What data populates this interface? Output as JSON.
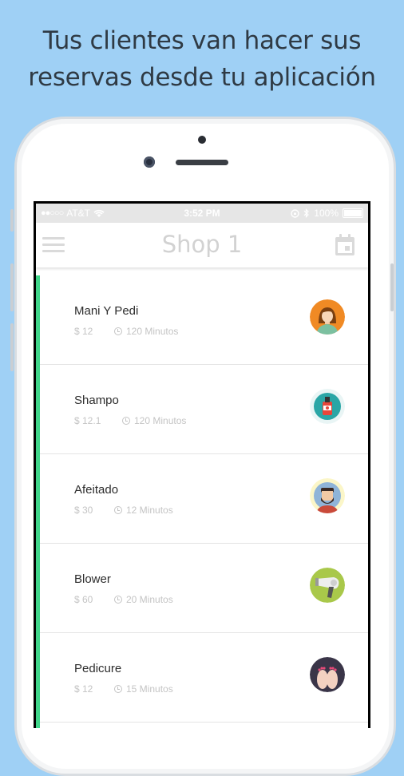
{
  "headline": {
    "line1": "Tus clientes van hacer sus",
    "line2": "reservas desde tu aplicación"
  },
  "status_bar": {
    "carrier": "AT&T",
    "time": "3:52 PM",
    "battery": "100%",
    "signal_dots": "●●○○○"
  },
  "app_bar": {
    "title": "Shop 1",
    "menu_icon": "hamburger-icon",
    "calendar_icon": "calendar-icon"
  },
  "accent_color": "#40d68a",
  "services": [
    {
      "name": "Mani Y Pedi",
      "price": "$ 12",
      "duration": "120 Minutos",
      "icon": "woman-avatar-icon",
      "color": "#f08a24"
    },
    {
      "name": "Shampo",
      "price": "$ 12.1",
      "duration": "120 Minutos",
      "icon": "shampoo-bottle-icon",
      "color": "#2aa6a6"
    },
    {
      "name": "Afeitado",
      "price": "$ 30",
      "duration": "12 Minutos",
      "icon": "bearded-man-icon",
      "color": "#f5e88c"
    },
    {
      "name": "Blower",
      "price": "$ 60",
      "duration": "20 Minutos",
      "icon": "hair-dryer-icon",
      "color": "#a9c84a"
    },
    {
      "name": "Pedicure",
      "price": "$ 12",
      "duration": "15 Minutos",
      "icon": "feet-icon",
      "color": "#3a3548"
    }
  ]
}
